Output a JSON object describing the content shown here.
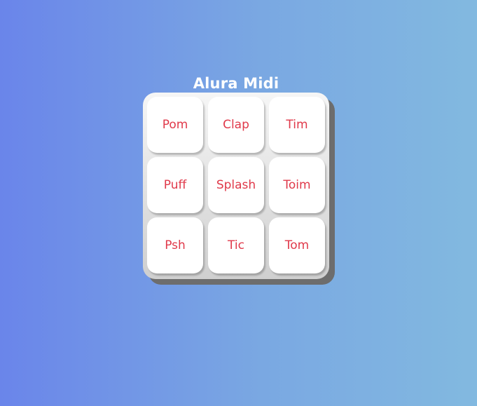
{
  "app": {
    "title": "Alura Midi"
  },
  "keypad": {
    "keys": [
      {
        "label": "Pom"
      },
      {
        "label": "Clap"
      },
      {
        "label": "Tim"
      },
      {
        "label": "Puff"
      },
      {
        "label": "Splash"
      },
      {
        "label": "Toim"
      },
      {
        "label": "Psh"
      },
      {
        "label": "Tic"
      },
      {
        "label": "Tom"
      }
    ]
  },
  "colors": {
    "background_start": "#6a85ea",
    "background_end": "#82b9e0",
    "title_text": "#ffffff",
    "key_text": "#e0394a",
    "key_background": "#ffffff",
    "keypad_background": "#e6e6e6"
  }
}
